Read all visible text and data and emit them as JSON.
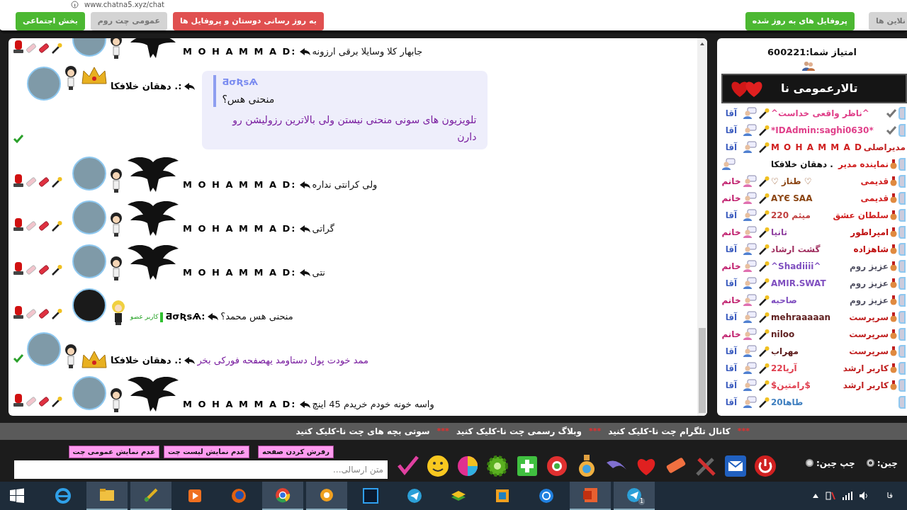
{
  "address_bar": {
    "url": "www.chatna5.xyz/chat"
  },
  "left_buttons": [
    {
      "label": "به روز رسانی دوستان و پروفایل ها",
      "color": "#e05050"
    },
    {
      "label": "عمومی چت روم",
      "color": "#d4d4d4"
    },
    {
      "label": "بخش اجتماعی",
      "color": "#4cb832"
    }
  ],
  "right_buttons": [
    {
      "label": "نلاین ها",
      "color": "#d4d4d4"
    },
    {
      "label": "پروفایل های به روز شده",
      "color": "#4cb832"
    }
  ],
  "messages": [
    {
      "kind": "moderator",
      "name": "M O H A M M A D:",
      "text": "جابهار کلا وسایلا برقی ارزونه",
      "color": "#111111"
    },
    {
      "kind": "vip",
      "name": "دهقان خلافکا .:",
      "quote": {
        "author": "ƋσƦѕѦ",
        "text": "منحنی هس؟"
      },
      "text": "تلویزیون های سونی منحنی نیستن ولی بالاترین رزولیشن رو دارن",
      "color": "#7a1fa0"
    },
    {
      "kind": "moderator",
      "name": "M O H A M M A D:",
      "text": "ولی کرانتی نداره",
      "color": "#111111"
    },
    {
      "kind": "moderator",
      "name": "M O H A M M A D:",
      "text": "گراتی",
      "color": "#111111"
    },
    {
      "kind": "moderator",
      "name": "M O H A M M A D:",
      "text": "نتی",
      "color": "#111111"
    },
    {
      "kind": "member",
      "badge": "کاربر عضو",
      "name": "ƋσƦѕѦ:",
      "text": "منحنی هس محمد؟",
      "color": "#111111"
    },
    {
      "kind": "vip",
      "name": "دهقان خلافکا .:",
      "text": "ممد خودت پول دستاومد یهصفحه فورکی بخر",
      "color": "#7a1fa0"
    },
    {
      "kind": "moderator",
      "name": "M O H A M M A D:",
      "text": "واسه خونه خودم خریدم 45 اینچ",
      "color": "#111111"
    }
  ],
  "sidebar": {
    "score": "امتیاز شما:600221",
    "room_title": "تالارعمومی نا",
    "users": [
      {
        "name": "^ناظر واقعی خداست^",
        "color": "#e0408a",
        "gender": {
          "label": "آقا",
          "kind": "male"
        },
        "verified": true
      },
      {
        "name": "*IDAdmin:saghi0630*",
        "color": "#e0408a",
        "gender": {
          "label": "آقا",
          "kind": "male"
        },
        "verified": true
      },
      {
        "name": "M O H A M M A D",
        "color": "#d02020",
        "gender": {
          "label": "آقا",
          "kind": "male"
        },
        "verified": false,
        "rank": {
          "label": "مدیراصلی",
          "color": "#c02020"
        }
      },
      {
        "name": "دهقان خلافکا .",
        "color": "#111111",
        "verified": false,
        "rank": {
          "label": "نماینده مدیر",
          "color": "#d02020"
        }
      },
      {
        "name": "♡ طناز ♡",
        "color": "#8b4513",
        "gender": {
          "label": "خانم",
          "kind": "female"
        },
        "verified": false,
        "rank": {
          "label": "قدیمی",
          "color": "#d02020"
        }
      },
      {
        "name": "ΑϒЄ ЅΑΑ",
        "color": "#8b4513",
        "gender": {
          "label": "خانم",
          "kind": "female"
        },
        "verified": false,
        "rank": {
          "label": "قدیمی",
          "color": "#d02020"
        }
      },
      {
        "name": "میثم 220",
        "color": "#c04040",
        "gender": {
          "label": "آقا",
          "kind": "male"
        },
        "verified": false,
        "rank": {
          "label": "سلطان عشق",
          "color": "#d02020"
        }
      },
      {
        "name": "تانیا",
        "color": "#9040a0",
        "gender": {
          "label": "خانم",
          "kind": "female"
        },
        "verified": false,
        "rank": {
          "label": "امپراطور",
          "color": "#c01010"
        }
      },
      {
        "name": "گشت ارشاد",
        "color": "#a03060",
        "gender": {
          "label": "آقا",
          "kind": "male"
        },
        "verified": false,
        "rank": {
          "label": "شاهزاده",
          "color": "#c01010"
        }
      },
      {
        "name": "^Shadiiii^",
        "color": "#8050c0",
        "gender": {
          "label": "خانم",
          "kind": "female"
        },
        "verified": false,
        "rank": {
          "label": "عزیز روم",
          "color": "#555566"
        }
      },
      {
        "name": "AMIR.SWAT",
        "color": "#8050c0",
        "gender": {
          "label": "آقا",
          "kind": "male"
        },
        "verified": false,
        "rank": {
          "label": "عزیز روم",
          "color": "#555566"
        }
      },
      {
        "name": "صاحبه",
        "color": "#8050c0",
        "gender": {
          "label": "خانم",
          "kind": "female"
        },
        "verified": false,
        "rank": {
          "label": "عزیز روم",
          "color": "#555566"
        }
      },
      {
        "name": "mehraaaaan",
        "color": "#602020",
        "gender": {
          "label": "آقا",
          "kind": "male"
        },
        "verified": false,
        "rank": {
          "label": "سرپرست",
          "color": "#c02020"
        }
      },
      {
        "name": "niloo",
        "color": "#602020",
        "gender": {
          "label": "خانم",
          "kind": "female"
        },
        "verified": false,
        "rank": {
          "label": "سرپرست",
          "color": "#c02020"
        }
      },
      {
        "name": "مهراب",
        "color": "#602020",
        "gender": {
          "label": "آقا",
          "kind": "male"
        },
        "verified": false,
        "rank": {
          "label": "سرپرست",
          "color": "#c02020"
        }
      },
      {
        "name": "آریا22",
        "color": "#e04050",
        "gender": {
          "label": "آقا",
          "kind": "male"
        },
        "verified": false,
        "rank": {
          "label": "کاربر ارشد",
          "color": "#c02020"
        }
      },
      {
        "name": "$رامتین$",
        "color": "#e04050",
        "gender": {
          "label": "آقا",
          "kind": "male"
        },
        "verified": false,
        "rank": {
          "label": "کاربر ارشد",
          "color": "#c02020"
        }
      },
      {
        "name": "طاها20",
        "color": "#4080c0",
        "gender": {
          "label": "آقا",
          "kind": "male"
        },
        "verified": false
      }
    ]
  },
  "ticker": [
    {
      "kind": "separator",
      "text": "***"
    },
    {
      "kind": "link",
      "text": "کانال تلگرام چت نا-کلیک کنید"
    },
    {
      "kind": "separator",
      "text": "***"
    },
    {
      "kind": "link",
      "text": "وبلاگ رسمی چت نا-کلیک کنید"
    },
    {
      "kind": "separator",
      "text": "***"
    },
    {
      "kind": "link",
      "text": "سوتی بچه های چت نا-کلیک کنید"
    }
  ],
  "composer": {
    "buttons": [
      "رفرش کردن صفحه",
      "عدم نمایش لیست چت",
      "عدم نمایش عمومی چت"
    ],
    "placeholder": "متن ارسالی...",
    "alignment": [
      {
        "label": "چین:",
        "selected": true
      },
      {
        "label": "چپ چین:",
        "selected": false
      }
    ]
  },
  "taskbar": {
    "apps": [
      {
        "kind": "ie",
        "active": false
      },
      {
        "kind": "folder",
        "active": true
      },
      {
        "kind": "paint",
        "active": true
      },
      {
        "kind": "media",
        "active": false
      },
      {
        "kind": "firefox",
        "active": false
      },
      {
        "kind": "chrome",
        "active": true
      },
      {
        "kind": "player",
        "active": true
      },
      {
        "kind": "photoshop",
        "active": false
      },
      {
        "kind": "telegram",
        "active": false
      },
      {
        "kind": "stack",
        "active": false
      },
      {
        "kind": "window",
        "active": false
      },
      {
        "kind": "share",
        "active": false
      },
      {
        "kind": "powerpoint",
        "active": true
      },
      {
        "kind": "telegram",
        "active": true,
        "badge": "1"
      }
    ],
    "language": "فا"
  }
}
